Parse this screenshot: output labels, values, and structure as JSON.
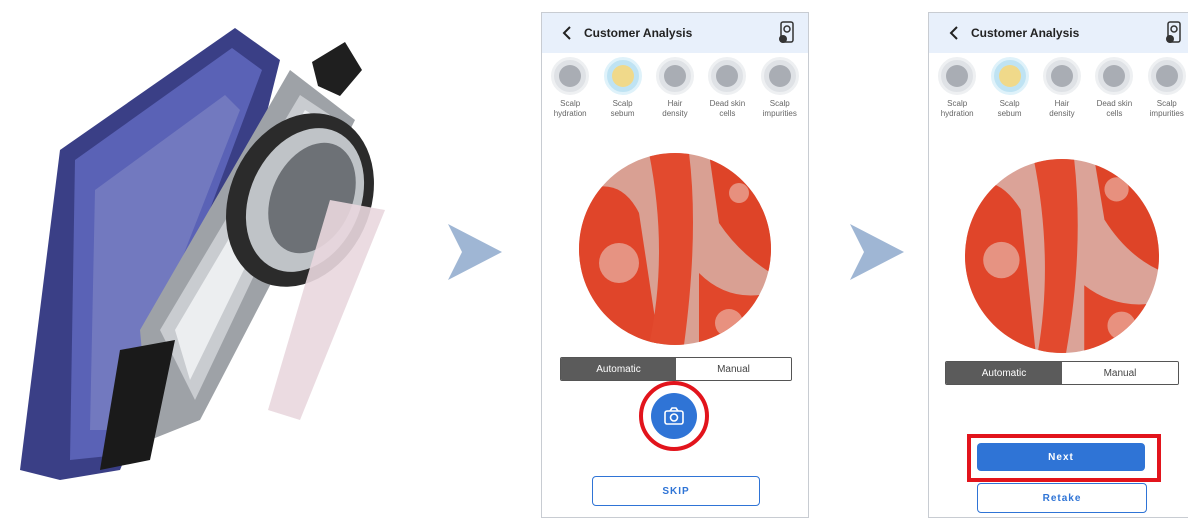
{
  "colors": {
    "accent": "#2f74d6",
    "highlight_red": "#e2141c",
    "appbar_bg": "#e8f0fb",
    "sample_red": "#e0452a",
    "arrow": "#9fb6d4"
  },
  "screens": [
    {
      "title": "Customer Analysis",
      "tabs": [
        {
          "label": "Scalp\nhydration",
          "icon": "scalp-hydration-icon"
        },
        {
          "label": "Scalp\nsebum",
          "icon": "scalp-sebum-icon"
        },
        {
          "label": "Hair\ndensity",
          "icon": "hair-density-icon"
        },
        {
          "label": "Dead skin\ncells",
          "icon": "dead-skin-cells-icon"
        },
        {
          "label": "Scalp\nimpurities",
          "icon": "scalp-impurities-icon"
        }
      ],
      "active_tab": "Scalp\nsebum",
      "mode": {
        "automatic": "Automatic",
        "manual": "Manual",
        "selected": "Automatic"
      },
      "skip_label": "SKIP"
    },
    {
      "title": "Customer Analysis",
      "tabs": [
        {
          "label": "Scalp\nhydration",
          "icon": "scalp-hydration-icon"
        },
        {
          "label": "Scalp\nsebum",
          "icon": "scalp-sebum-icon"
        },
        {
          "label": "Hair\ndensity",
          "icon": "hair-density-icon"
        },
        {
          "label": "Dead skin\ncells",
          "icon": "dead-skin-cells-icon"
        },
        {
          "label": "Scalp\nimpurities",
          "icon": "scalp-impurities-icon"
        }
      ],
      "active_tab": "Scalp\nsebum",
      "mode": {
        "automatic": "Automatic",
        "manual": "Manual",
        "selected": "Automatic"
      },
      "next_label": "Next",
      "retake_label": "Retake"
    }
  ]
}
